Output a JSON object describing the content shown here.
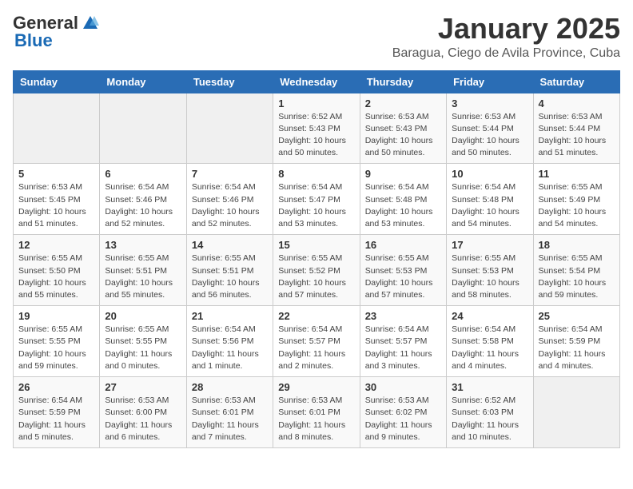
{
  "header": {
    "logo_general": "General",
    "logo_blue": "Blue",
    "month": "January 2025",
    "location": "Baragua, Ciego de Avila Province, Cuba"
  },
  "days_of_week": [
    "Sunday",
    "Monday",
    "Tuesday",
    "Wednesday",
    "Thursday",
    "Friday",
    "Saturday"
  ],
  "weeks": [
    [
      {
        "day": "",
        "info": ""
      },
      {
        "day": "",
        "info": ""
      },
      {
        "day": "",
        "info": ""
      },
      {
        "day": "1",
        "info": "Sunrise: 6:52 AM\nSunset: 5:43 PM\nDaylight: 10 hours\nand 50 minutes."
      },
      {
        "day": "2",
        "info": "Sunrise: 6:53 AM\nSunset: 5:43 PM\nDaylight: 10 hours\nand 50 minutes."
      },
      {
        "day": "3",
        "info": "Sunrise: 6:53 AM\nSunset: 5:44 PM\nDaylight: 10 hours\nand 50 minutes."
      },
      {
        "day": "4",
        "info": "Sunrise: 6:53 AM\nSunset: 5:44 PM\nDaylight: 10 hours\nand 51 minutes."
      }
    ],
    [
      {
        "day": "5",
        "info": "Sunrise: 6:53 AM\nSunset: 5:45 PM\nDaylight: 10 hours\nand 51 minutes."
      },
      {
        "day": "6",
        "info": "Sunrise: 6:54 AM\nSunset: 5:46 PM\nDaylight: 10 hours\nand 52 minutes."
      },
      {
        "day": "7",
        "info": "Sunrise: 6:54 AM\nSunset: 5:46 PM\nDaylight: 10 hours\nand 52 minutes."
      },
      {
        "day": "8",
        "info": "Sunrise: 6:54 AM\nSunset: 5:47 PM\nDaylight: 10 hours\nand 53 minutes."
      },
      {
        "day": "9",
        "info": "Sunrise: 6:54 AM\nSunset: 5:48 PM\nDaylight: 10 hours\nand 53 minutes."
      },
      {
        "day": "10",
        "info": "Sunrise: 6:54 AM\nSunset: 5:48 PM\nDaylight: 10 hours\nand 54 minutes."
      },
      {
        "day": "11",
        "info": "Sunrise: 6:55 AM\nSunset: 5:49 PM\nDaylight: 10 hours\nand 54 minutes."
      }
    ],
    [
      {
        "day": "12",
        "info": "Sunrise: 6:55 AM\nSunset: 5:50 PM\nDaylight: 10 hours\nand 55 minutes."
      },
      {
        "day": "13",
        "info": "Sunrise: 6:55 AM\nSunset: 5:51 PM\nDaylight: 10 hours\nand 55 minutes."
      },
      {
        "day": "14",
        "info": "Sunrise: 6:55 AM\nSunset: 5:51 PM\nDaylight: 10 hours\nand 56 minutes."
      },
      {
        "day": "15",
        "info": "Sunrise: 6:55 AM\nSunset: 5:52 PM\nDaylight: 10 hours\nand 57 minutes."
      },
      {
        "day": "16",
        "info": "Sunrise: 6:55 AM\nSunset: 5:53 PM\nDaylight: 10 hours\nand 57 minutes."
      },
      {
        "day": "17",
        "info": "Sunrise: 6:55 AM\nSunset: 5:53 PM\nDaylight: 10 hours\nand 58 minutes."
      },
      {
        "day": "18",
        "info": "Sunrise: 6:55 AM\nSunset: 5:54 PM\nDaylight: 10 hours\nand 59 minutes."
      }
    ],
    [
      {
        "day": "19",
        "info": "Sunrise: 6:55 AM\nSunset: 5:55 PM\nDaylight: 10 hours\nand 59 minutes."
      },
      {
        "day": "20",
        "info": "Sunrise: 6:55 AM\nSunset: 5:55 PM\nDaylight: 11 hours\nand 0 minutes."
      },
      {
        "day": "21",
        "info": "Sunrise: 6:54 AM\nSunset: 5:56 PM\nDaylight: 11 hours\nand 1 minute."
      },
      {
        "day": "22",
        "info": "Sunrise: 6:54 AM\nSunset: 5:57 PM\nDaylight: 11 hours\nand 2 minutes."
      },
      {
        "day": "23",
        "info": "Sunrise: 6:54 AM\nSunset: 5:57 PM\nDaylight: 11 hours\nand 3 minutes."
      },
      {
        "day": "24",
        "info": "Sunrise: 6:54 AM\nSunset: 5:58 PM\nDaylight: 11 hours\nand 4 minutes."
      },
      {
        "day": "25",
        "info": "Sunrise: 6:54 AM\nSunset: 5:59 PM\nDaylight: 11 hours\nand 4 minutes."
      }
    ],
    [
      {
        "day": "26",
        "info": "Sunrise: 6:54 AM\nSunset: 5:59 PM\nDaylight: 11 hours\nand 5 minutes."
      },
      {
        "day": "27",
        "info": "Sunrise: 6:53 AM\nSunset: 6:00 PM\nDaylight: 11 hours\nand 6 minutes."
      },
      {
        "day": "28",
        "info": "Sunrise: 6:53 AM\nSunset: 6:01 PM\nDaylight: 11 hours\nand 7 minutes."
      },
      {
        "day": "29",
        "info": "Sunrise: 6:53 AM\nSunset: 6:01 PM\nDaylight: 11 hours\nand 8 minutes."
      },
      {
        "day": "30",
        "info": "Sunrise: 6:53 AM\nSunset: 6:02 PM\nDaylight: 11 hours\nand 9 minutes."
      },
      {
        "day": "31",
        "info": "Sunrise: 6:52 AM\nSunset: 6:03 PM\nDaylight: 11 hours\nand 10 minutes."
      },
      {
        "day": "",
        "info": ""
      }
    ]
  ]
}
